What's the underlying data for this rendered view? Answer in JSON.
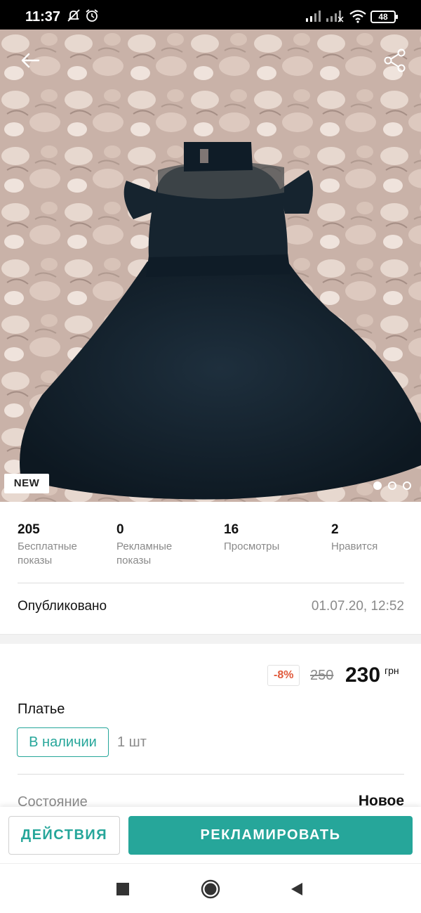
{
  "status_bar": {
    "time": "11:37",
    "battery": "48",
    "icons": [
      "mute-bell-icon",
      "alarm-icon",
      "signal-icon",
      "signal-icon",
      "wifi-icon",
      "battery-icon"
    ]
  },
  "photo": {
    "badge": "NEW",
    "page_count": 3,
    "active_page": 1,
    "icons": [
      "back-arrow-icon",
      "share-icon"
    ]
  },
  "stats": [
    {
      "value": "205",
      "label": "Бесплатные показы"
    },
    {
      "value": "0",
      "label": "Рекламные показы"
    },
    {
      "value": "16",
      "label": "Просмотры"
    },
    {
      "value": "2",
      "label": "Нравится"
    }
  ],
  "published": {
    "label": "Опубликовано",
    "date": "01.07.20, 12:52"
  },
  "price": {
    "discount": "-8%",
    "old": "250",
    "current": "230",
    "currency": "грн"
  },
  "item": {
    "title": "Платье",
    "stock_status": "В наличии",
    "quantity": "1 шт",
    "condition_label": "Состояние",
    "condition_value": "Новое"
  },
  "actions": {
    "secondary": "ДЕЙСТВИЯ",
    "primary": "РЕКЛАМИРОВАТЬ"
  },
  "colors": {
    "accent": "#26a69a",
    "discount": "#e05a3c",
    "muted": "#8a8a8a"
  }
}
